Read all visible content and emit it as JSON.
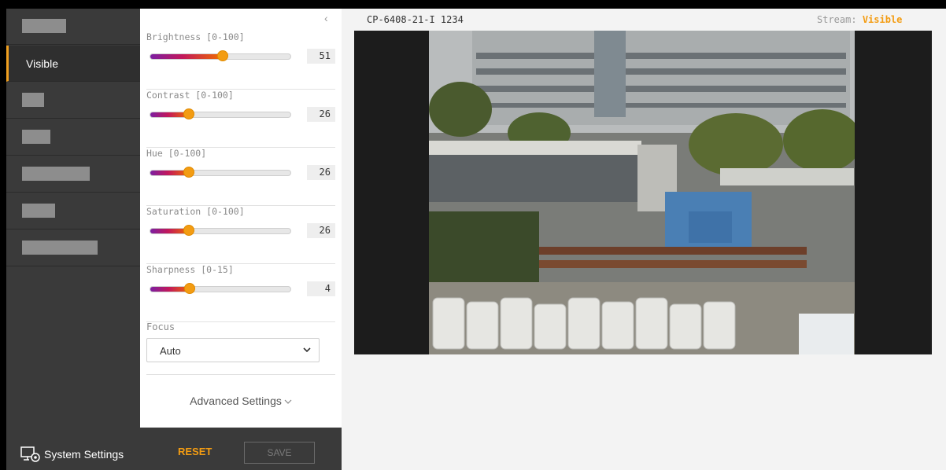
{
  "sidebar": {
    "items": [
      {
        "label": "",
        "redacted": true
      },
      {
        "label": "Visible",
        "active": true
      },
      {
        "label": "",
        "redacted": true
      },
      {
        "label": "",
        "redacted": true
      },
      {
        "label": "",
        "redacted": true
      },
      {
        "label": "",
        "redacted": true
      },
      {
        "label": "",
        "redacted": true
      }
    ],
    "system_settings_label": "System Settings"
  },
  "panel": {
    "sliders": [
      {
        "label": "Brightness [0-100]",
        "value": "51",
        "fraction": 0.51
      },
      {
        "label": "Contrast [0-100]",
        "value": "26",
        "fraction": 0.26
      },
      {
        "label": "Hue [0-100]",
        "value": "26",
        "fraction": 0.26
      },
      {
        "label": "Saturation [0-100]",
        "value": "26",
        "fraction": 0.26
      },
      {
        "label": "Sharpness [0-15]",
        "value": "4",
        "fraction": 0.267
      }
    ],
    "focus": {
      "label": "Focus",
      "selected": "Auto"
    },
    "advanced_label": "Advanced Settings"
  },
  "actions": {
    "reset_label": "RESET",
    "save_label": "SAVE"
  },
  "video": {
    "camera_id": "CP-6408-21-I 1234",
    "stream_label": "Stream:",
    "stream_value": "Visible"
  },
  "colors": {
    "accent": "#f39c12",
    "sidebar": "#3a3a3a"
  }
}
